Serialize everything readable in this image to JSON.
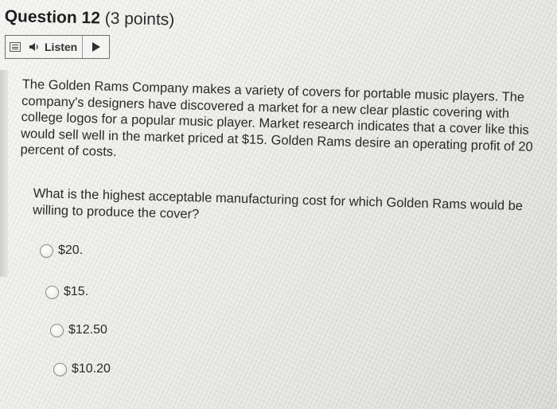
{
  "question": {
    "title": "Question 12",
    "points": "(3 points)"
  },
  "toolbar": {
    "listen_label": "Listen",
    "icons": [
      "menu-icon",
      "speaker-icon",
      "play-icon"
    ]
  },
  "body": {
    "paragraph1": "The Golden Rams Company makes a variety of covers for portable music players. The company's designers have discovered a market for a new clear plastic covering with college logos for a popular music player. Market research indicates that a cover like this would sell well in the market priced at $15. Golden Rams desire an operating profit of 20 percent of costs.",
    "paragraph2": "What is the highest acceptable manufacturing cost for which Golden Rams would be willing to produce the cover?"
  },
  "options": [
    {
      "label": "$20."
    },
    {
      "label": "$15."
    },
    {
      "label": "$12.50"
    },
    {
      "label": "$10.20"
    }
  ]
}
